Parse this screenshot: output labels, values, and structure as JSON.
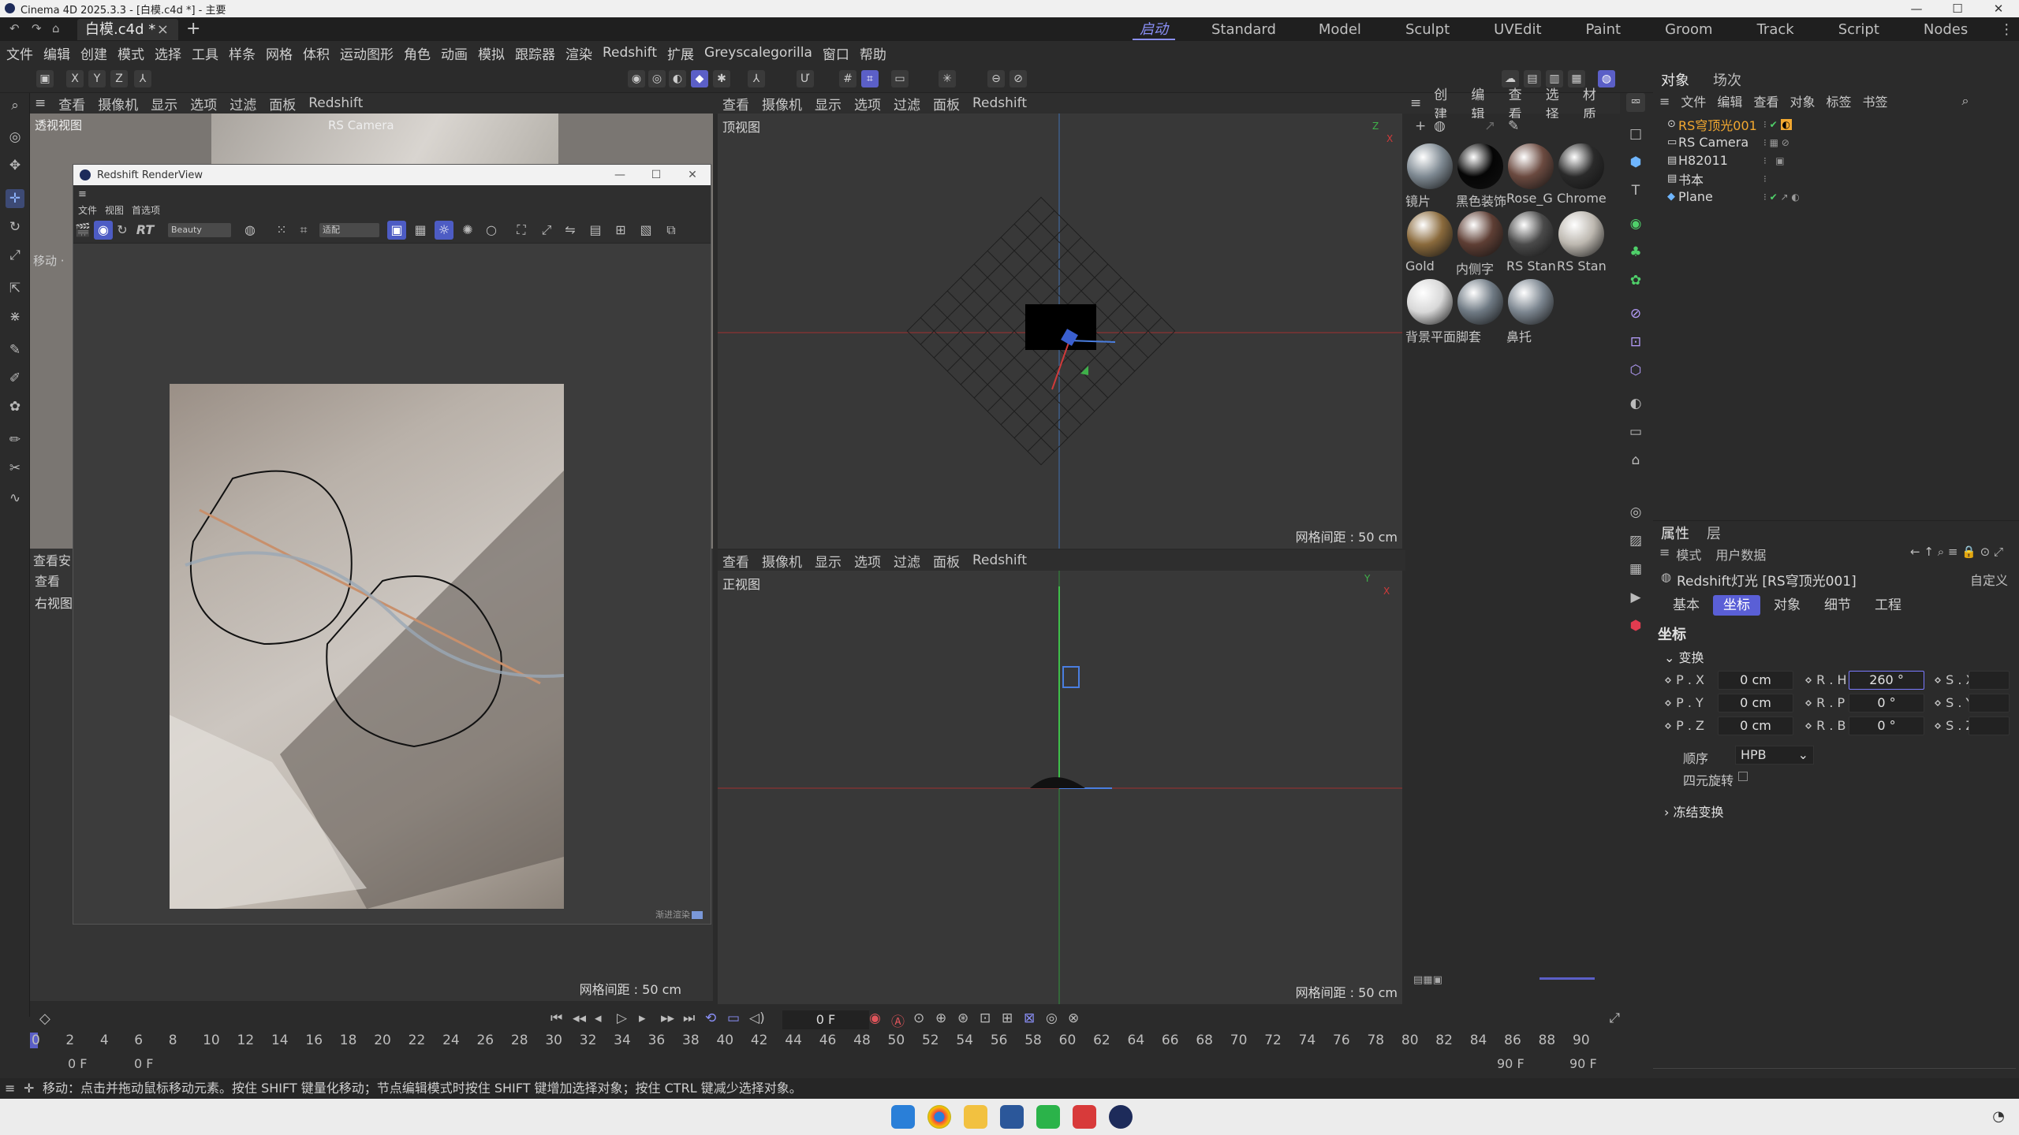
{
  "window": {
    "title": "Cinema 4D 2025.3.3 - [白模.c4d *] - 主要",
    "controls": [
      "—",
      "☐",
      "✕"
    ]
  },
  "tabs": {
    "doc": "白模.c4d *",
    "close": "×",
    "plus": "+"
  },
  "layouts": [
    "启动",
    "Standard",
    "Model",
    "Sculpt",
    "UVEdit",
    "Paint",
    "Groom",
    "Track",
    "Script",
    "Nodes"
  ],
  "menu": [
    "文件",
    "编辑",
    "创建",
    "模式",
    "选择",
    "工具",
    "样条",
    "网格",
    "体积",
    "运动图形",
    "角色",
    "动画",
    "模拟",
    "跟踪器",
    "渲染",
    "Redshift",
    "扩展",
    "Greyscalegorilla",
    "窗口",
    "帮助"
  ],
  "toolbar": {
    "axes": [
      "X",
      "Y",
      "Z"
    ]
  },
  "viewport_menu": [
    "查看",
    "摄像机",
    "显示",
    "选项",
    "过滤",
    "面板",
    "Redshift"
  ],
  "viewports": {
    "perspective": {
      "label": "透视视图",
      "camera": "RS Camera",
      "hint": "移动 ·"
    },
    "top": {
      "label": "顶视图",
      "grid": "网格间距 : 50 cm"
    },
    "front": {
      "label": "正视图",
      "grid": "网格间距 : 50 cm"
    },
    "right": {
      "label": "右视图",
      "grid": "网格间距 : 50 cm",
      "menu_view": "查看",
      "menu_short": "查看安"
    }
  },
  "renderview": {
    "title": "Redshift RenderView",
    "menu": [
      "文件",
      "视图",
      "首选项"
    ],
    "rt": "RT",
    "aov": "Beauty",
    "zoom": "适配",
    "footer": "渐进渲染"
  },
  "materials": [
    {
      "name": "镜片",
      "color": "#7f8a93"
    },
    {
      "name": "黑色装饰",
      "color": "#050505"
    },
    {
      "name": "Rose_G",
      "color": "#6b4a40"
    },
    {
      "name": "Chrome",
      "color": "#2a2a2a"
    },
    {
      "name": "Gold",
      "color": "#8a6a3c"
    },
    {
      "name": "内侧字",
      "color": "#5e3e34"
    },
    {
      "name": "RS Stan",
      "color": "#4a4a4a"
    },
    {
      "name": "RS Stan",
      "color": "#bdb8b0"
    },
    {
      "name": "背景平面",
      "color": "#d8d8d8"
    },
    {
      "name": "脚套",
      "color": "#6f7a84"
    },
    {
      "name": "鼻托",
      "color": "#7c8690"
    }
  ],
  "material_menu": [
    "创建",
    "编辑",
    "查看",
    "选择",
    "材质"
  ],
  "objects": {
    "tabs": [
      "对象",
      "场次"
    ],
    "menu": [
      "文件",
      "编辑",
      "查看",
      "对象",
      "标签",
      "书签"
    ],
    "rows": [
      {
        "name": "RS穹顶光001",
        "icon": "⊙",
        "selected": true
      },
      {
        "name": "RS Camera",
        "icon": "▭",
        "selected": false
      },
      {
        "name": "H82011",
        "icon": "▤",
        "selected": false
      },
      {
        "name": "书本",
        "icon": "▤",
        "selected": false
      },
      {
        "name": "Plane",
        "icon": "◆",
        "selected": false
      }
    ]
  },
  "attributes": {
    "tabs": [
      "属性",
      "层"
    ],
    "menu": [
      "模式",
      "用户数据"
    ],
    "object_title": "Redshift灯光 [RS穹顶光001]",
    "preset": "自定义",
    "subtabs": [
      "基本",
      "坐标",
      "对象",
      "细节",
      "工程"
    ],
    "section": "坐标",
    "group_transform": "变换",
    "px": "0 cm",
    "py": "0 cm",
    "pz": "0 cm",
    "rh": "260 °",
    "rp": "0 °",
    "rb": "0 °",
    "labels": {
      "px": "P . X",
      "py": "P . Y",
      "pz": "P . Z",
      "rh": "R . H",
      "rp": "R . P",
      "rb": "R . B",
      "sx": "S . X",
      "sy": "S . Y",
      "sz": "S . Z"
    },
    "order_label": "顺序",
    "order_value": "HPB",
    "quat_label": "四元旋转",
    "freeze": "冻结变换"
  },
  "timeline": {
    "ticks": [
      "0",
      "2",
      "4",
      "6",
      "8",
      "10",
      "12",
      "14",
      "16",
      "18",
      "20",
      "22",
      "24",
      "26",
      "28",
      "30",
      "32",
      "34",
      "36",
      "38",
      "40",
      "42",
      "44",
      "46",
      "48",
      "50",
      "52",
      "54",
      "56",
      "58",
      "60",
      "62",
      "64",
      "66",
      "68",
      "70",
      "72",
      "74",
      "76",
      "78",
      "80",
      "82",
      "84",
      "86",
      "88",
      "90"
    ],
    "current_frame": "0 F",
    "start": "0 F",
    "start2": "0 F",
    "end": "90 F",
    "end2": "90 F"
  },
  "status": "移动：点击并拖动鼠标移动元素。按住 SHIFT 键量化移动；节点编辑模式时按住 SHIFT 键增加选择对象；按住 CTRL 键减少选择对象。"
}
